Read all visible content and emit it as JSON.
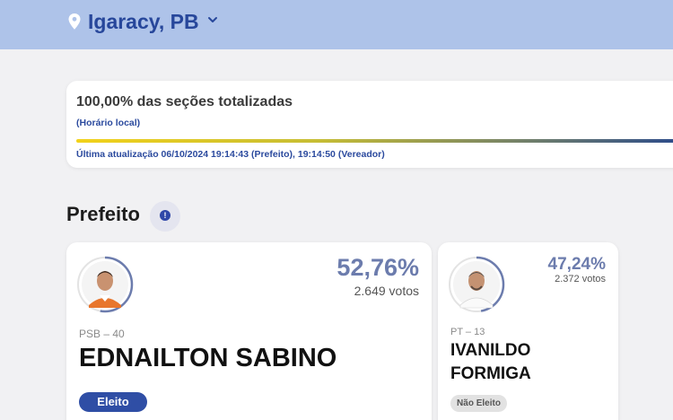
{
  "header": {
    "location": "Igaracy, PB",
    "location_icon": "map-pin-icon",
    "dropdown_icon": "chevron-down-icon"
  },
  "status": {
    "title": "100,00% das seções totalizadas",
    "subtitle": "(Horário local)",
    "progress_percent": 100,
    "last_update": "Última atualização 06/10/2024 19:14:43 (Prefeito), 19:14:50 (Vereador)"
  },
  "section": {
    "title": "Prefeito",
    "info_icon": "info-icon"
  },
  "candidates": [
    {
      "percent": "52,76%",
      "votes": "2.649 votos",
      "party": "PSB – 40",
      "name": "EDNAILTON SABINO",
      "status": "Eleito",
      "vote_share": 52.76
    },
    {
      "percent": "47,24%",
      "votes": "2.372 votos",
      "party": "PT – 13",
      "name_line1": "IVANILDO",
      "name_line2": "FORMIGA",
      "status": "Não Eleito",
      "vote_share": 47.24
    }
  ],
  "colors": {
    "header_bg": "#aec3e9",
    "accent_blue": "#27479b",
    "elected_badge": "#2f4ea5",
    "not_elected_badge": "#e2e2e2",
    "percent_text": "#6c7cad"
  }
}
